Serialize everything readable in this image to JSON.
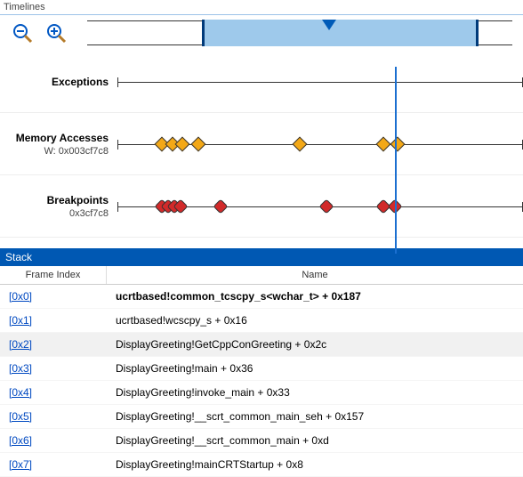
{
  "timelines": {
    "title": "Timelines",
    "icons": {
      "zoom_out": "zoom-out",
      "zoom_in": "zoom-in"
    },
    "overview": {
      "range_start_pct": 27,
      "range_end_pct": 92,
      "marker_pct": 57
    },
    "playhead_pct": 68.5,
    "lanes": [
      {
        "title": "Exceptions",
        "sub": "",
        "marker_shape": "diamond",
        "marker_color": "d-orange",
        "positions_pct": []
      },
      {
        "title": "Memory Accesses",
        "sub": "W: 0x003cf7c8",
        "marker_shape": "diamond",
        "marker_color": "d-orange",
        "positions_pct": [
          11,
          13.5,
          16,
          20,
          45,
          65.5,
          69
        ]
      },
      {
        "title": "Breakpoints",
        "sub": "0x3cf7c8",
        "marker_shape": "round",
        "marker_color": "d-red",
        "positions_pct": [
          11,
          12.5,
          14,
          15.5,
          25.5,
          51.5,
          65.5,
          68.5
        ]
      }
    ]
  },
  "stack": {
    "title": "Stack",
    "columns": {
      "frame": "Frame Index",
      "name": "Name"
    },
    "rows": [
      {
        "frame": "[0x0]",
        "name": "ucrtbased!common_tcscpy_s<wchar_t> + 0x187",
        "bold": true
      },
      {
        "frame": "[0x1]",
        "name": "ucrtbased!wcscpy_s + 0x16"
      },
      {
        "frame": "[0x2]",
        "name": "DisplayGreeting!GetCppConGreeting + 0x2c",
        "selected": true
      },
      {
        "frame": "[0x3]",
        "name": "DisplayGreeting!main + 0x36"
      },
      {
        "frame": "[0x4]",
        "name": "DisplayGreeting!invoke_main + 0x33"
      },
      {
        "frame": "[0x5]",
        "name": "DisplayGreeting!__scrt_common_main_seh + 0x157"
      },
      {
        "frame": "[0x6]",
        "name": "DisplayGreeting!__scrt_common_main + 0xd"
      },
      {
        "frame": "[0x7]",
        "name": "DisplayGreeting!mainCRTStartup + 0x8"
      }
    ]
  }
}
